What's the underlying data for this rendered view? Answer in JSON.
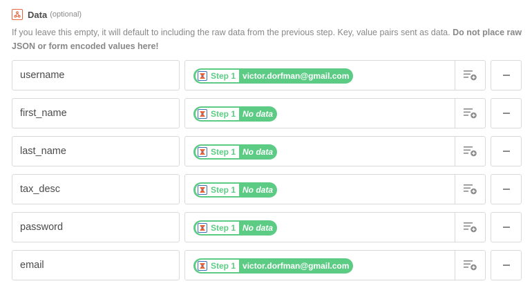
{
  "field": {
    "title": "Data",
    "optional": "(optional)",
    "help_text": "If you leave this empty, it will default to including the raw data from the previous step. Key, value pairs sent as data.",
    "help_bold": "Do not place raw JSON or form encoded values here!"
  },
  "colors": {
    "accent_orange": "#e8643c",
    "pill_green": "#5ccc85",
    "border": "#d9d9d9"
  },
  "icons": {
    "field": "webhook-icon",
    "app": "app-logo-icon",
    "insert": "insert-field-icon",
    "remove": "minus-icon"
  },
  "rows": [
    {
      "key": "username",
      "step": "Step 1",
      "value": "victor.dorfman@gmail.com",
      "no_data": false
    },
    {
      "key": "first_name",
      "step": "Step 1",
      "value": "No data",
      "no_data": true
    },
    {
      "key": "last_name",
      "step": "Step 1",
      "value": "No data",
      "no_data": true
    },
    {
      "key": "tax_desc",
      "step": "Step 1",
      "value": "No data",
      "no_data": true
    },
    {
      "key": "password",
      "step": "Step 1",
      "value": "No data",
      "no_data": true
    },
    {
      "key": "email",
      "step": "Step 1",
      "value": "victor.dorfman@gmail.com",
      "no_data": false
    }
  ]
}
